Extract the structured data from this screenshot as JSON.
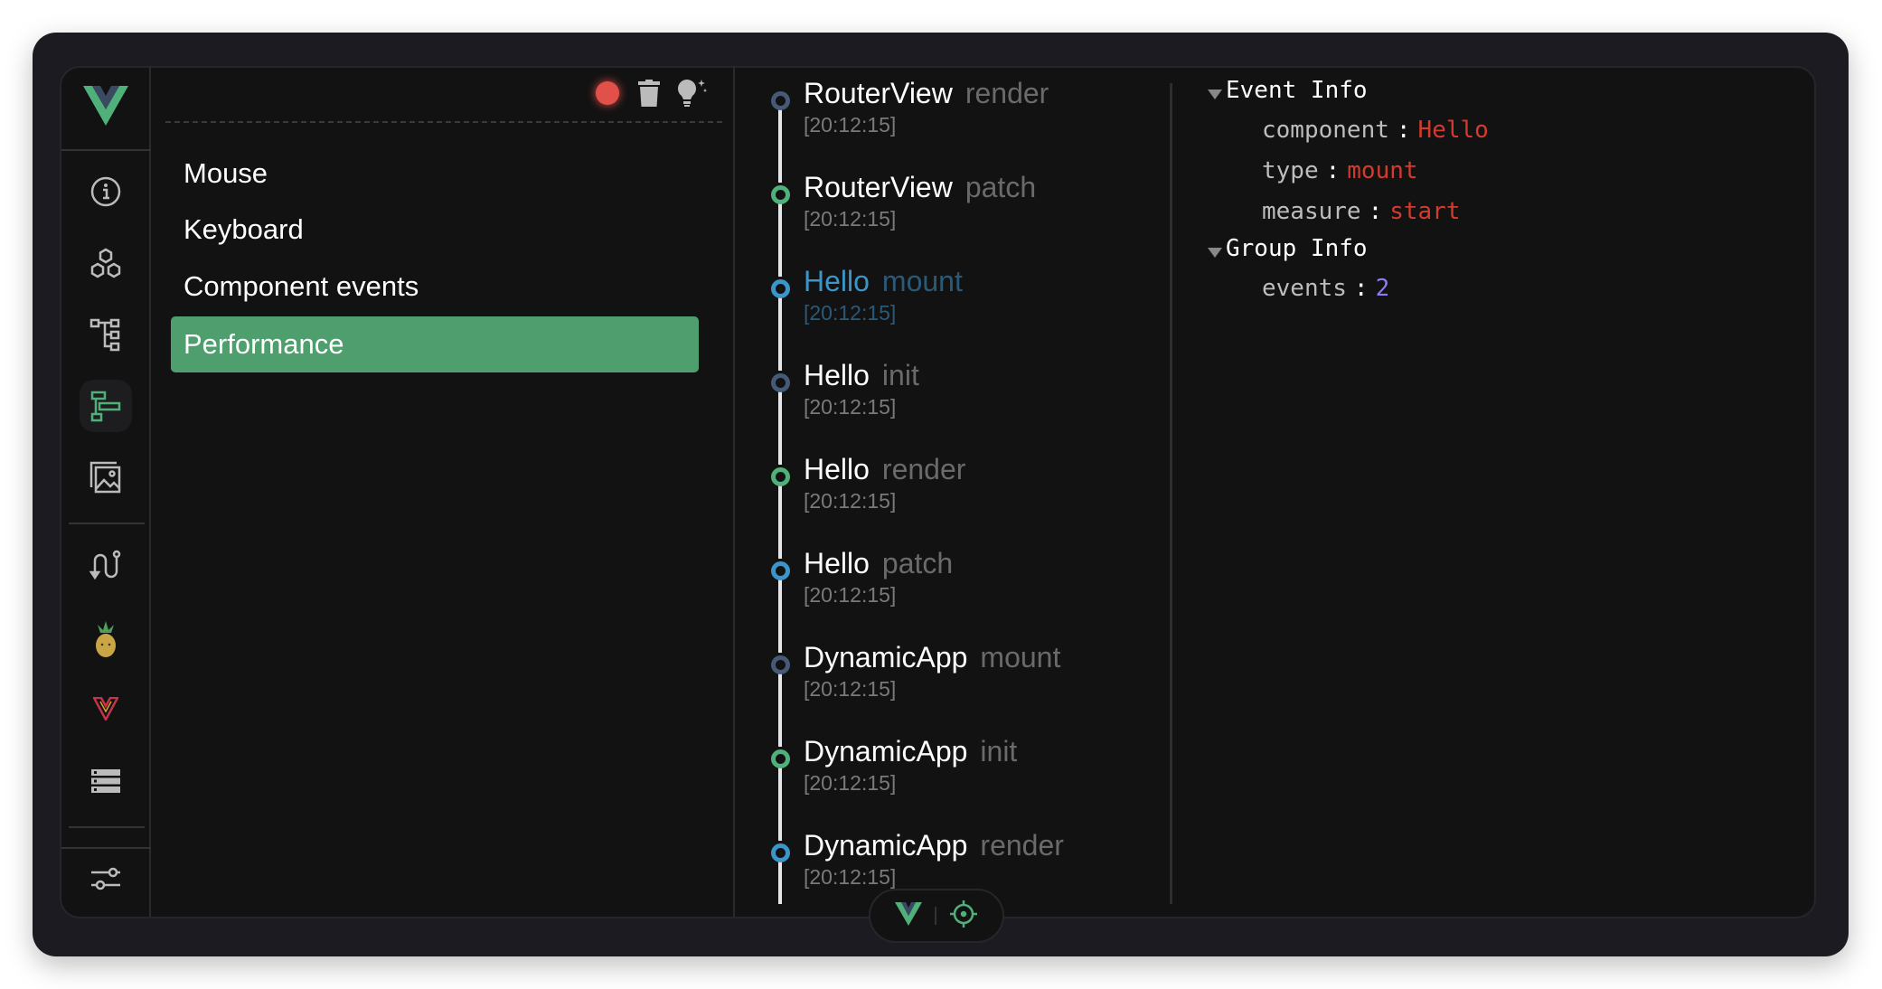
{
  "sidebar": {
    "items": [
      {
        "icon": "info-icon"
      },
      {
        "icon": "components-icon"
      },
      {
        "icon": "tree-icon"
      },
      {
        "icon": "timeline-icon",
        "active": true
      },
      {
        "icon": "assets-icon"
      },
      {
        "icon": "router-icon"
      },
      {
        "icon": "pinia-icon"
      },
      {
        "icon": "vue-plugin-icon"
      },
      {
        "icon": "storage-icon"
      },
      {
        "icon": "settings-sliders-icon"
      }
    ]
  },
  "toolbar": {
    "record": "record-icon",
    "clear": "trash-icon",
    "tips": "lightbulb-icon"
  },
  "layers": [
    {
      "label": "Mouse"
    },
    {
      "label": "Keyboard"
    },
    {
      "label": "Component events"
    },
    {
      "label": "Performance",
      "selected": true
    }
  ],
  "events": [
    {
      "name": "RouterView",
      "type": "render",
      "time": "[20:12:15]",
      "color": "#445a76"
    },
    {
      "name": "RouterView",
      "type": "patch",
      "time": "[20:12:15]",
      "color": "#4fb07a"
    },
    {
      "name": "Hello",
      "type": "mount",
      "time": "[20:12:15]",
      "color": "#3b95c9",
      "selected": true
    },
    {
      "name": "Hello",
      "type": "init",
      "time": "[20:12:15]",
      "color": "#445a76"
    },
    {
      "name": "Hello",
      "type": "render",
      "time": "[20:12:15]",
      "color": "#4fb07a"
    },
    {
      "name": "Hello",
      "type": "patch",
      "time": "[20:12:15]",
      "color": "#3b95c9"
    },
    {
      "name": "DynamicApp",
      "type": "mount",
      "time": "[20:12:15]",
      "color": "#445a76"
    },
    {
      "name": "DynamicApp",
      "type": "init",
      "time": "[20:12:15]",
      "color": "#4fb07a"
    },
    {
      "name": "DynamicApp",
      "type": "render",
      "time": "[20:12:15]",
      "color": "#3b95c9"
    }
  ],
  "details": {
    "event_info": {
      "title": "Event Info",
      "fields": [
        {
          "key": "component",
          "value": "Hello"
        },
        {
          "key": "type",
          "value": "mount"
        },
        {
          "key": "measure",
          "value": "start"
        }
      ]
    },
    "group_info": {
      "title": "Group Info",
      "fields": [
        {
          "key": "events",
          "value": "2"
        }
      ]
    }
  },
  "colors": {
    "accent": "#4f9e6e",
    "string": "#d23b2d",
    "number": "#8c7cf0"
  }
}
